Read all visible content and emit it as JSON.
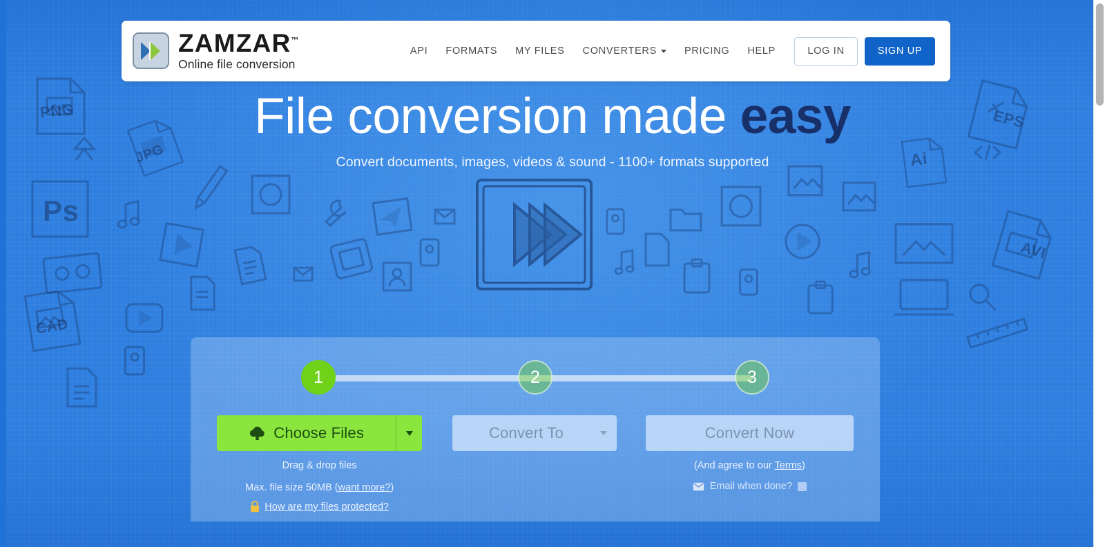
{
  "brand": {
    "name": "ZAMZAR",
    "tm": "™",
    "tagline": "Online file conversion",
    "logo_icon": "double-chevron-icon",
    "logo_blue": "#2f6fb5",
    "logo_green": "#8cc63f"
  },
  "nav": {
    "items": [
      {
        "label": "API",
        "caret": false
      },
      {
        "label": "FORMATS",
        "caret": false
      },
      {
        "label": "MY FILES",
        "caret": false
      },
      {
        "label": "CONVERTERS",
        "caret": true
      },
      {
        "label": "PRICING",
        "caret": false
      },
      {
        "label": "HELP",
        "caret": false
      }
    ],
    "login_label": "LOG IN",
    "signup_label": "SIGN UP",
    "signup_color": "#1064c9"
  },
  "hero": {
    "title_main": "File conversion made ",
    "title_accent": "easy",
    "subtitle": "Convert documents, images, videos & sound - 1100+ formats supported",
    "art_icon": "play-button-sketch-icon"
  },
  "converter": {
    "steps": [
      {
        "number": "1",
        "state": "active"
      },
      {
        "number": "2",
        "state": "inactive"
      },
      {
        "number": "3",
        "state": "inactive"
      }
    ],
    "choose_files": {
      "label": "Choose Files",
      "icon": "cloud-upload-icon",
      "dropdown_icon": "caret-down-icon",
      "color": "#8ae53c"
    },
    "convert_to": {
      "label": "Convert To",
      "dropdown_icon": "caret-down-icon",
      "disabled": true
    },
    "convert_now": {
      "label": "Convert Now",
      "disabled": true
    },
    "helper_left": {
      "drag_drop": "Drag & drop files",
      "max_size_prefix": "Max. file size 50MB (",
      "max_size_link": "want more?",
      "max_size_suffix": ")",
      "protected_link": "How are my files protected?",
      "lock_icon": "lock-icon"
    },
    "helper_right": {
      "terms_prefix": "(And agree to our ",
      "terms_link": "Terms",
      "terms_suffix": ")",
      "email_label": "Email when done?",
      "email_icon": "envelope-icon",
      "email_checked": false
    }
  },
  "background": {
    "doodle_labels": [
      "PNG",
      "JPG",
      "Ps",
      "CAD",
      "EPS",
      "Ai",
      "AVI"
    ]
  }
}
